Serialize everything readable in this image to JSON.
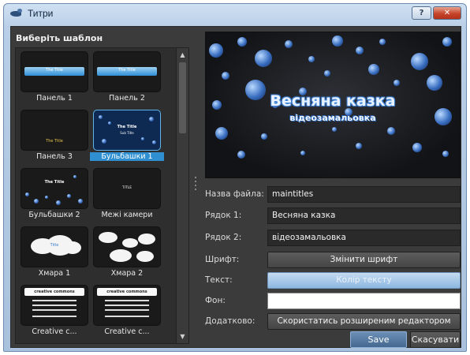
{
  "window": {
    "title": "Титри",
    "help_label": "?",
    "close_label": "✕"
  },
  "templates": {
    "heading": "Виберіть шаблон",
    "items": [
      {
        "label": "Панель 1",
        "thumb_text": "The Title"
      },
      {
        "label": "Панель 2",
        "thumb_text": "The Title"
      },
      {
        "label": "Панель 3",
        "thumb_text": "The Title"
      },
      {
        "label": "Бульбашки 1",
        "thumb_text": "The Title",
        "thumb_sub": "Sub Title",
        "selected": true
      },
      {
        "label": "Бульбашки 2",
        "thumb_text": "The Title"
      },
      {
        "label": "Межі камери",
        "thumb_text": "TITLE"
      },
      {
        "label": "Хмара 1",
        "thumb_text": "Title"
      },
      {
        "label": "Хмара 2",
        "thumb_text": ""
      },
      {
        "label": "Creative c...",
        "thumb_text": "creative commons"
      },
      {
        "label": "Creative c...",
        "thumb_text": "creative commons"
      }
    ]
  },
  "preview": {
    "title": "Весняна казка",
    "subtitle": "відеозамальовка"
  },
  "form": {
    "filename_label": "Назва файла:",
    "filename_value": "maintitles",
    "line1_label": "Рядок 1:",
    "line1_value": "Весняна казка",
    "line2_label": "Рядок 2:",
    "line2_value": "відеозамальовка",
    "font_label": "Шрифт:",
    "font_button": "Змінити шрифт",
    "text_label": "Текст:",
    "text_button": "Колір тексту",
    "bg_label": "Фон:",
    "bg_value": "",
    "extra_label": "Додатково:",
    "extra_button": "Скористатись розширеним редактором"
  },
  "footer": {
    "save_label": "Save",
    "cancel_label": "Скасувати"
  },
  "colors": {
    "accent": "#2f8fd1",
    "text_color_button": "#9cc0e6",
    "background_swatch": "#ffffff"
  }
}
